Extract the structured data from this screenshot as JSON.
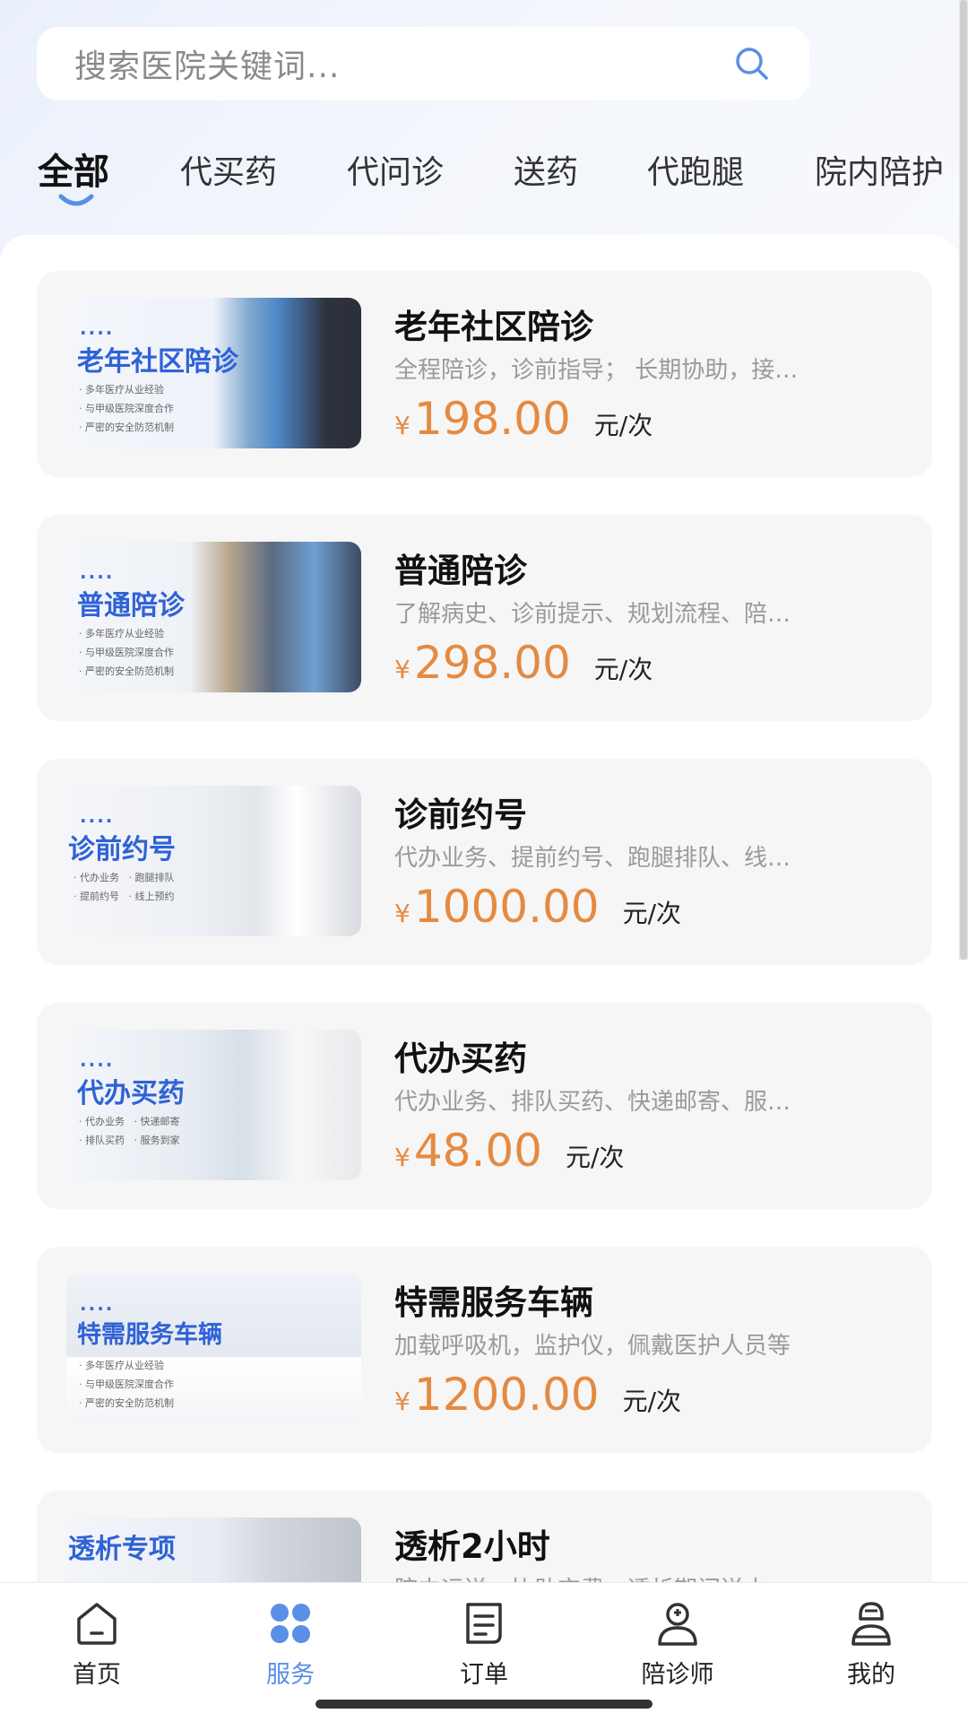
{
  "search": {
    "placeholder": "搜索医院关键词..."
  },
  "tabs": [
    {
      "label": "全部",
      "active": true
    },
    {
      "label": "代买药"
    },
    {
      "label": "代问诊"
    },
    {
      "label": "送药"
    },
    {
      "label": "代跑腿"
    },
    {
      "label": "院内陪护"
    }
  ],
  "services": [
    {
      "title": "老年社区陪诊",
      "description": "全程陪诊，诊前指导； 长期协助，接…",
      "currency": "¥",
      "price": "198.00",
      "unit": "元/次",
      "thumb": {
        "dots": "....",
        "title": "老年社区陪诊",
        "bullets": "· 多年医疗从业经验\n· 与甲级医院深度合作\n· 严密的安全防范机制"
      }
    },
    {
      "title": "普通陪诊",
      "description": "了解病史、诊前提示、规划流程、陪…",
      "currency": "¥",
      "price": "298.00",
      "unit": "元/次",
      "thumb": {
        "dots": "....",
        "title": "普通陪诊",
        "bullets": "· 多年医疗从业经验\n· 与甲级医院深度合作\n· 严密的安全防范机制"
      }
    },
    {
      "title": "诊前约号",
      "description": "代办业务、提前约号、跑腿排队、线…",
      "currency": "¥",
      "price": "1000.00",
      "unit": "元/次",
      "thumb": {
        "dots": "....",
        "title": "诊前约号",
        "bullets": "· 代办业务   · 跑腿排队\n· 提前约号   · 线上预约"
      }
    },
    {
      "title": "代办买药",
      "description": "代办业务、排队买药、快递邮寄、服…",
      "currency": "¥",
      "price": "48.00",
      "unit": "元/次",
      "thumb": {
        "dots": "....",
        "title": "代办买药",
        "bullets": "· 代办业务   · 快递邮寄\n· 排队买药   · 服务到家"
      }
    },
    {
      "title": "特需服务车辆",
      "description": "加载呼吸机，监护仪，佩戴医护人员等",
      "currency": "¥",
      "price": "1200.00",
      "unit": "元/次",
      "thumb": {
        "dots": "....",
        "title": "特需服务车辆",
        "bullets": "· 多年医疗从业经验\n· 与甲级医院深度合作\n· 严密的安全防范机制"
      }
    },
    {
      "title": "透析2小时",
      "description": "院内运送、协助交费、透析期间送水…",
      "currency": "¥",
      "price": "",
      "unit": "",
      "thumb": {
        "dots": "",
        "title": "透析专项",
        "bullets": ""
      }
    }
  ],
  "nav": [
    {
      "label": "首页",
      "icon": "home-icon"
    },
    {
      "label": "服务",
      "icon": "services-grid-icon",
      "active": true
    },
    {
      "label": "订单",
      "icon": "orders-icon"
    },
    {
      "label": "陪诊师",
      "icon": "escort-icon"
    },
    {
      "label": "我的",
      "icon": "profile-icon"
    }
  ],
  "colors": {
    "accent": "#5a8fe6",
    "price": "#e58a41",
    "card_bg": "#f6f6f6",
    "thumb_title": "#2f62d6"
  }
}
